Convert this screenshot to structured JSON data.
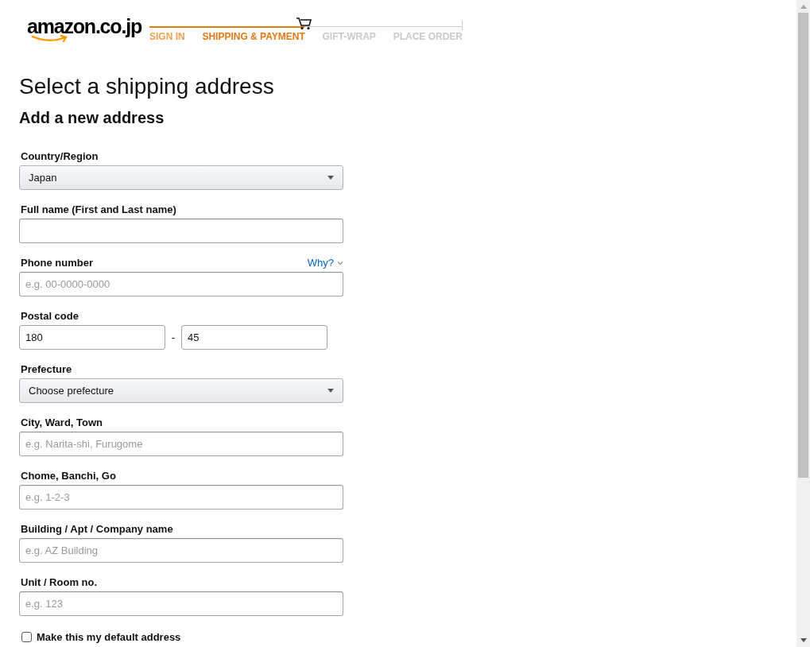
{
  "header": {
    "logo": "amazon.co.jp",
    "steps": [
      {
        "label": "SIGN IN",
        "selected": false
      },
      {
        "label": "SHIPPING & PAYMENT",
        "selected": true
      },
      {
        "label": "GIFT-WRAP",
        "selected": false
      },
      {
        "label": "PLACE ORDER",
        "selected": false
      }
    ]
  },
  "title": "Select a shipping address",
  "subtitle": "Add a new address",
  "fields": [
    {
      "kind": "select",
      "label": "Country/Region",
      "value": "Japan"
    },
    {
      "kind": "text",
      "label": "Full name (First and Last name)"
    },
    {
      "kind": "text",
      "label": "Phone number",
      "link": "Why?",
      "placeholder": "e.g. 00-0000-0000"
    },
    {
      "kind": "postal",
      "label": "Postal code",
      "parts": [
        "180",
        "45"
      ],
      "separator": "-"
    },
    {
      "kind": "select",
      "label": "Prefecture",
      "value": "Choose prefecture"
    },
    {
      "kind": "text",
      "label": "City, Ward, Town",
      "placeholder": "e.g. Narita-shi, Furugome"
    },
    {
      "kind": "text",
      "label": "Chome, Banchi, Go",
      "placeholder": "e.g. 1-2-3"
    },
    {
      "kind": "text",
      "label": "Building / Apt / Company name",
      "placeholder": "e.g. AZ Building"
    },
    {
      "kind": "text",
      "label": "Unit / Room no.",
      "placeholder": "e.g. 123"
    }
  ],
  "default_address": {
    "label": "Make this my default address",
    "checked": false
  }
}
